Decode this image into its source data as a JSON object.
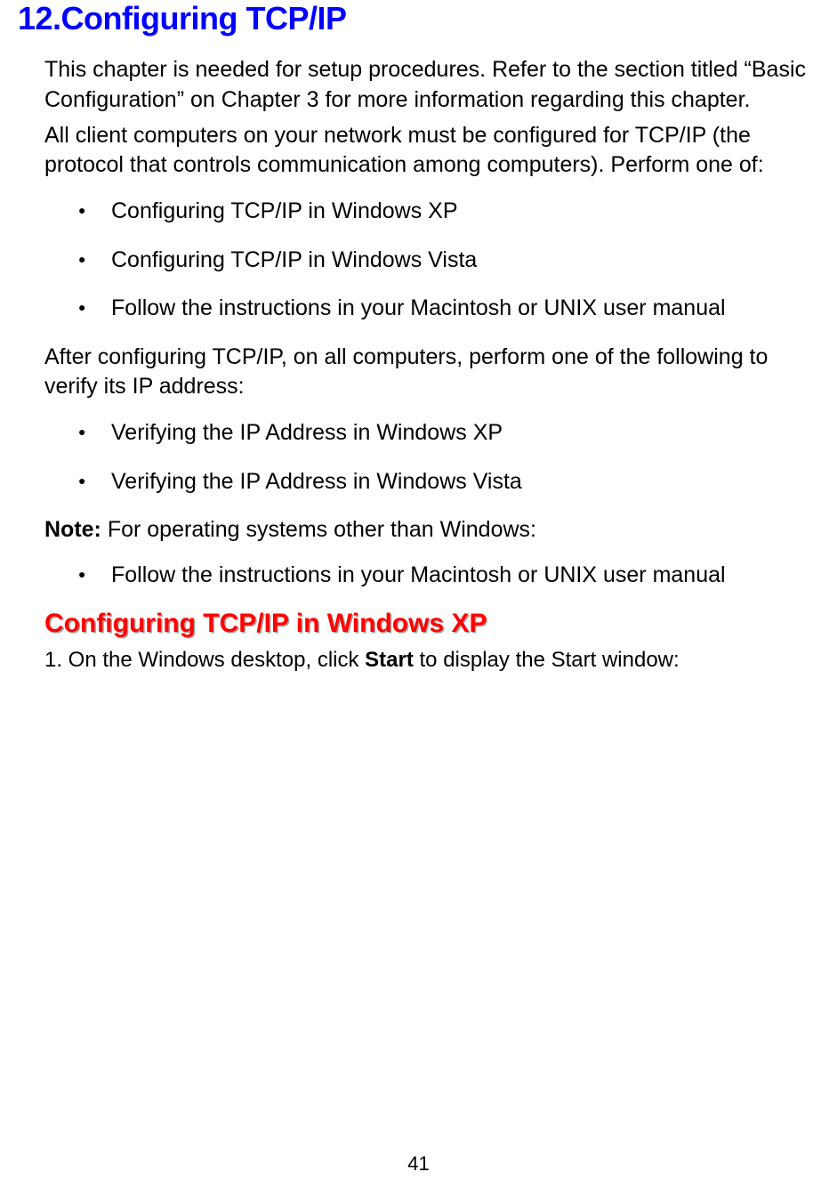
{
  "chapter": {
    "title": "12.Configuring TCP/IP"
  },
  "intro": {
    "p1": "This chapter is needed for setup procedures. Refer to the section titled “Basic Configuration” on Chapter 3 for more information regarding this chapter.",
    "p2": "All client computers on your network must be configured for TCP/IP (the protocol that controls communication among computers). Perform one of:"
  },
  "list1": {
    "items": [
      "Configuring TCP/IP in Windows XP",
      "Configuring TCP/IP in Windows Vista",
      "Follow the instructions in your Macintosh or UNIX user manual"
    ]
  },
  "mid": {
    "p1": "After configuring TCP/IP, on all computers, perform one of the following to verify its IP address:"
  },
  "list2": {
    "items": [
      "Verifying the IP Address in Windows XP",
      "Verifying the IP Address in Windows Vista"
    ]
  },
  "note": {
    "label": "Note:",
    "text": " For operating systems other than Windows:"
  },
  "list3": {
    "items": [
      "Follow the instructions in your Macintosh or UNIX user manual"
    ]
  },
  "section": {
    "title": "Configuring TCP/IP in Windows XP"
  },
  "step1": {
    "prefix": "1. On the Windows desktop, click ",
    "bold": "Start",
    "suffix": " to display the Start window:"
  },
  "page_number": "41"
}
